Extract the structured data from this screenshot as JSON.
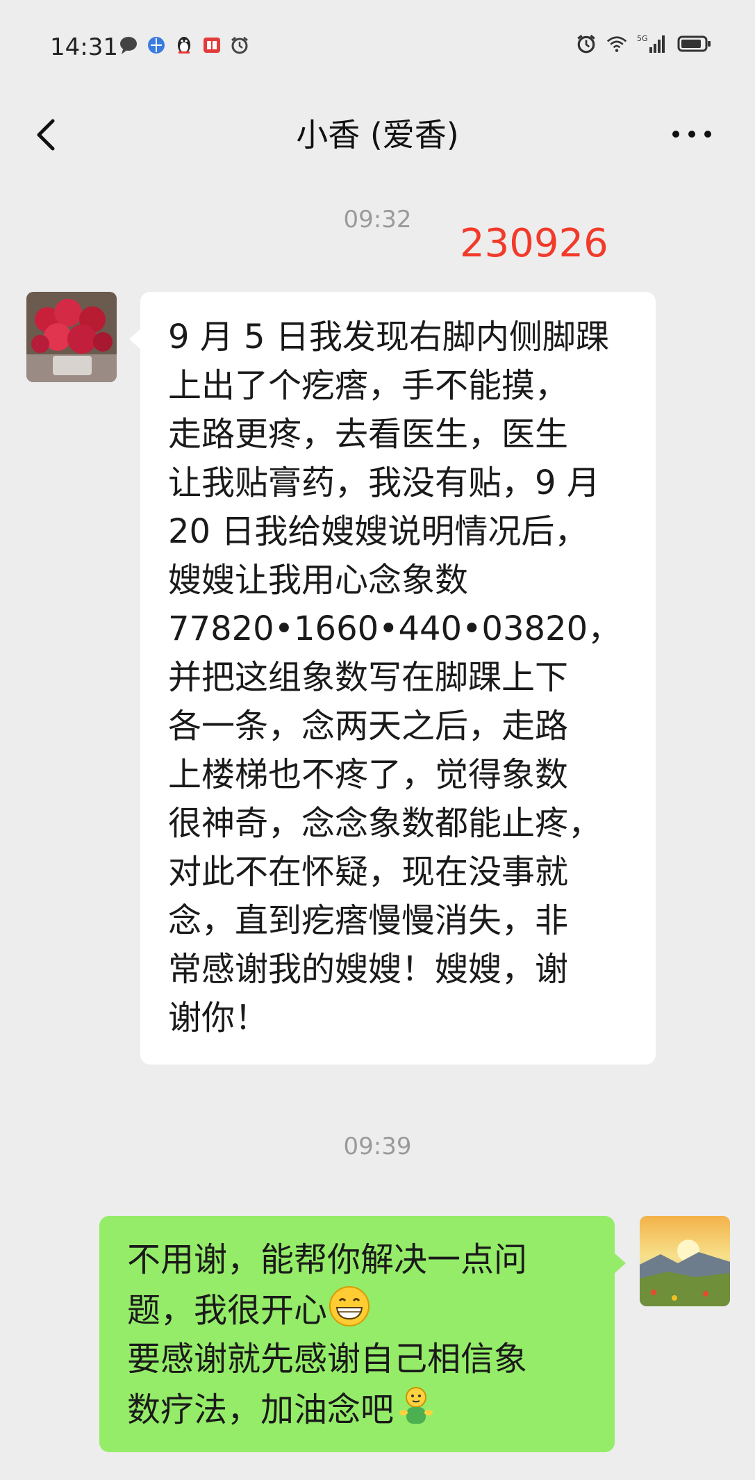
{
  "status_bar": {
    "time": "14:31",
    "left_icons": [
      "chat-notification-icon",
      "browser-icon",
      "qq-penguin-icon",
      "reader-app-icon",
      "alarm-icon"
    ],
    "right_icons": [
      "alarm-icon",
      "wifi-icon",
      "5g-signal-icon",
      "battery-icon"
    ],
    "signal_label": "5G"
  },
  "header": {
    "title": "小香 (爱香)"
  },
  "annotation": "230926",
  "messages": [
    {
      "timestamp": "09:32",
      "direction": "incoming",
      "lines": [
        "9 月 5 日我发现右脚内侧脚踝",
        "上出了个疙瘩，手不能摸，",
        "走路更疼，去看医生，医生",
        "让我贴膏药，我没有贴，9 月",
        "20 日我给嫂嫂说明情况后，",
        "嫂嫂让我用心念象数",
        "77820•1660•440•03820，",
        "并把这组象数写在脚踝上下",
        "各一条，念两天之后，走路",
        "上楼梯也不疼了，觉得象数",
        "很神奇，念念象数都能止疼，",
        "对此不在怀疑，现在没事就",
        "念，直到疙瘩慢慢消失，非",
        "常感谢我的嫂嫂！嫂嫂，谢",
        "谢你！"
      ]
    },
    {
      "timestamp": "09:39",
      "direction": "outgoing",
      "lines": [
        "不用谢，能帮你解决一点问",
        "题，我很开心",
        "要感谢就先感谢自己相信象",
        "数疗法，加油念吧"
      ],
      "emojis": [
        "grin-emoji-icon",
        "green-figure-emoji-icon"
      ]
    }
  ],
  "colors": {
    "background": "#ededed",
    "incoming_bubble": "#ffffff",
    "outgoing_bubble": "#95ec69",
    "annotation": "#f23a2a",
    "timestamp": "#9a9a9a"
  }
}
